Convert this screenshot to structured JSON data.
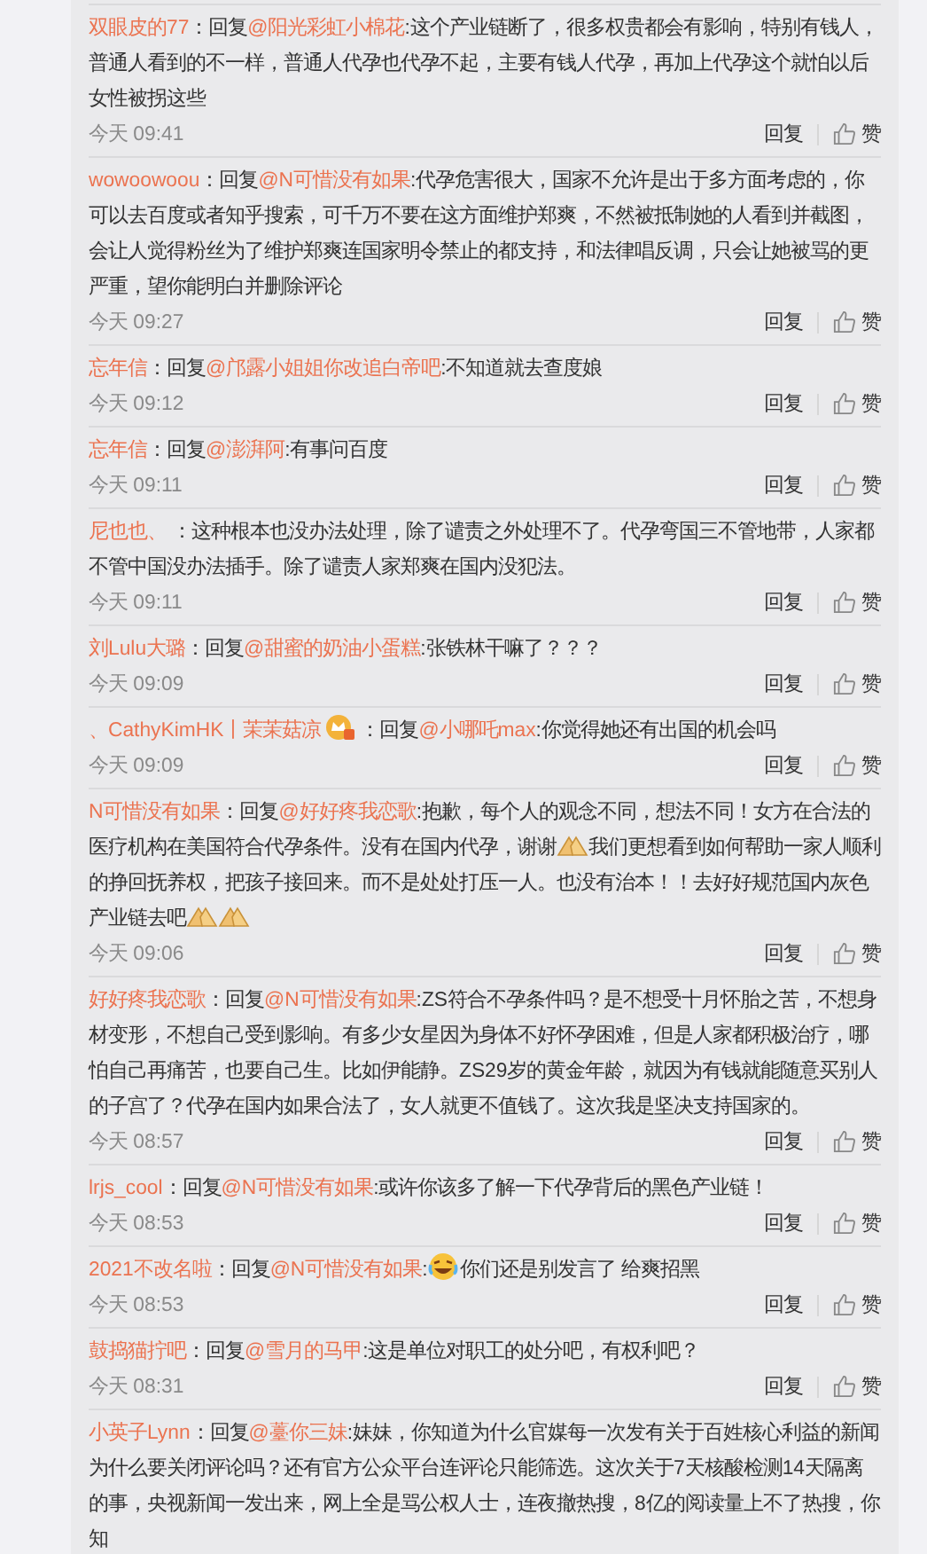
{
  "comments": [
    {
      "user": "双眼皮的77",
      "badge": false,
      "segments": [
        {
          "kind": "text",
          "text": "：回复"
        },
        {
          "kind": "mention",
          "text": "@阳光彩虹小棉花"
        },
        {
          "kind": "text",
          "text": ":这个产业链断了，很多权贵都会有影响，特别有钱人，普通人看到的不一样，普通人代孕也代孕不起，主要有钱人代孕，再加上代孕这个就怕以后女性被拐这些"
        }
      ],
      "time": "今天 09:41",
      "reply_button": "回复",
      "like_button": "赞"
    },
    {
      "user": "wowoowoou",
      "badge": false,
      "segments": [
        {
          "kind": "text",
          "text": "：回复"
        },
        {
          "kind": "mention",
          "text": "@N可惜没有如果"
        },
        {
          "kind": "text",
          "text": ":代孕危害很大，国家不允许是出于多方面考虑的，你可以去百度或者知乎搜索，可千万不要在这方面维护郑爽，不然被抵制她的人看到并截图，会让人觉得粉丝为了维护郑爽连国家明令禁止的都支持，和法律唱反调，只会让她被骂的更严重，望你能明白并删除评论"
        }
      ],
      "time": "今天 09:27",
      "reply_button": "回复",
      "like_button": "赞"
    },
    {
      "user": "忘年信",
      "badge": false,
      "segments": [
        {
          "kind": "text",
          "text": "：回复"
        },
        {
          "kind": "mention",
          "text": "@邝露小姐姐你改追白帝吧"
        },
        {
          "kind": "text",
          "text": ":不知道就去查度娘"
        }
      ],
      "time": "今天 09:12",
      "reply_button": "回复",
      "like_button": "赞"
    },
    {
      "user": "忘年信",
      "badge": false,
      "segments": [
        {
          "kind": "text",
          "text": "：回复"
        },
        {
          "kind": "mention",
          "text": "@澎湃阿"
        },
        {
          "kind": "text",
          "text": ":有事问百度"
        }
      ],
      "time": "今天 09:11",
      "reply_button": "回复",
      "like_button": "赞"
    },
    {
      "user": "尼也也、",
      "badge": false,
      "segments": [
        {
          "kind": "text",
          "text": " ：这种根本也没办法处理，除了谴责之外处理不了。代孕弯国三不管地带，人家都不管中国没办法插手。除了谴责人家郑爽在国内没犯法。"
        }
      ],
      "time": "今天 09:11",
      "reply_button": "回复",
      "like_button": "赞"
    },
    {
      "user": "刘Lulu大璐",
      "badge": false,
      "segments": [
        {
          "kind": "text",
          "text": "：回复"
        },
        {
          "kind": "mention",
          "text": "@甜蜜的奶油小蛋糕"
        },
        {
          "kind": "text",
          "text": ":张铁林干嘛了？？？"
        }
      ],
      "time": "今天 09:09",
      "reply_button": "回复",
      "like_button": "赞"
    },
    {
      "user": "、CathyKimHK丨茉茉菇凉",
      "badge": true,
      "segments": [
        {
          "kind": "text",
          "text": "：回复"
        },
        {
          "kind": "mention",
          "text": "@小哪吒max"
        },
        {
          "kind": "text",
          "text": ":你觉得她还有出国的机会吗"
        }
      ],
      "time": "今天 09:09",
      "reply_button": "回复",
      "like_button": "赞"
    },
    {
      "user": "N可惜没有如果",
      "badge": false,
      "segments": [
        {
          "kind": "text",
          "text": "：回复"
        },
        {
          "kind": "mention",
          "text": "@好好疼我恋歌"
        },
        {
          "kind": "text",
          "text": ":抱歉，每个人的观念不同，想法不同！女方在合法的医疗机构在美国符合代孕条件。没有在国内代孕，谢谢"
        },
        {
          "kind": "pray_emoji"
        },
        {
          "kind": "text",
          "text": "我们更想看到如何帮助一家人顺利的挣回抚养权，把孩子接回来。而不是处处打压一人。也没有治本！！去好好规范国内灰色产业链去吧"
        },
        {
          "kind": "pray_emoji"
        },
        {
          "kind": "pray_emoji"
        }
      ],
      "time": "今天 09:06",
      "reply_button": "回复",
      "like_button": "赞"
    },
    {
      "user": "好好疼我恋歌",
      "badge": false,
      "segments": [
        {
          "kind": "text",
          "text": "：回复"
        },
        {
          "kind": "mention",
          "text": "@N可惜没有如果"
        },
        {
          "kind": "text",
          "text": ":ZS符合不孕条件吗？是不想受十月怀胎之苦，不想身材变形，不想自己受到影响。有多少女星因为身体不好怀孕困难，但是人家都积极治疗，哪怕自己再痛苦，也要自己生。比如伊能静。ZS29岁的黄金年龄，就因为有钱就能随意买别人的子宫了？代孕在国内如果合法了，女人就更不值钱了。这次我是坚决支持国家的。"
        }
      ],
      "time": "今天 08:57",
      "reply_button": "回复",
      "like_button": "赞"
    },
    {
      "user": "lrjs_cool",
      "badge": false,
      "segments": [
        {
          "kind": "text",
          "text": "：回复"
        },
        {
          "kind": "mention",
          "text": "@N可惜没有如果"
        },
        {
          "kind": "text",
          "text": ":或许你该多了解一下代孕背后的黑色产业链！"
        }
      ],
      "time": "今天 08:53",
      "reply_button": "回复",
      "like_button": "赞"
    },
    {
      "user": "2021不改名啦",
      "badge": false,
      "segments": [
        {
          "kind": "text",
          "text": "：回复"
        },
        {
          "kind": "mention",
          "text": "@N可惜没有如果"
        },
        {
          "kind": "text",
          "text": ":"
        },
        {
          "kind": "laugh_emoji"
        },
        {
          "kind": "text",
          "text": "你们还是别发言了 给爽招黑"
        }
      ],
      "time": "今天 08:53",
      "reply_button": "回复",
      "like_button": "赞"
    },
    {
      "user": "鼓捣猫拧吧",
      "badge": false,
      "segments": [
        {
          "kind": "text",
          "text": "：回复"
        },
        {
          "kind": "mention",
          "text": "@雪月的马甲"
        },
        {
          "kind": "text",
          "text": ":这是单位对职工的处分吧，有权利吧？"
        }
      ],
      "time": "今天 08:31",
      "reply_button": "回复",
      "like_button": "赞"
    },
    {
      "user": "小英子Lynn",
      "badge": false,
      "segments": [
        {
          "kind": "text",
          "text": "：回复"
        },
        {
          "kind": "mention",
          "text": "@薹你三妹"
        },
        {
          "kind": "text",
          "text": ":妹妹，你知道为什么官媒每一次发有关于百姓核心利益的新闻为什么要关闭评论吗？还有官方公众平台连评论只能筛选。这次关于7天核酸检测14天隔离的事，央视新闻一发出来，网上全是骂公权人士，连夜撤热搜，8亿的阅读量上不了热搜，你知"
        }
      ]
    }
  ]
}
